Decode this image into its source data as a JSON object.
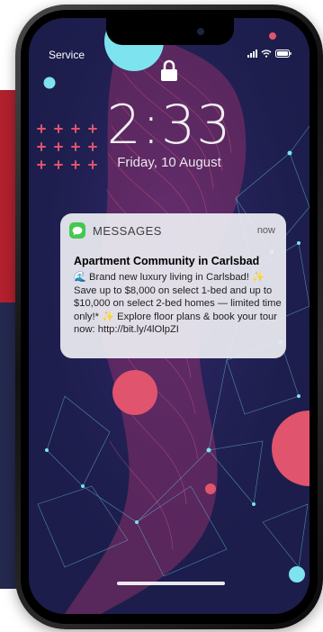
{
  "status_bar": {
    "carrier": "Service"
  },
  "lock_screen": {
    "time": "2:33",
    "date": "Friday, 10 August"
  },
  "notification": {
    "app_name": "MESSAGES",
    "timestamp": "now",
    "title": "Apartment Community in Carlsbad",
    "body": "🌊 Brand new luxury living in Carlsbad! ✨ Save up to $8,000 on select 1-bed and up to $10,000 on select 2-bed homes — limited time only!* ✨ Explore floor plans & book your tour now: http://bit.ly/4lOlpZI",
    "app_icon": "messages-icon",
    "app_color": "#42c94f"
  },
  "colors": {
    "wallpaper_base": "#1c1d4b",
    "accent_pink": "#e0546d",
    "accent_cyan": "#7de3ef",
    "side_red": "#b3202f",
    "side_navy": "#242a4e"
  }
}
